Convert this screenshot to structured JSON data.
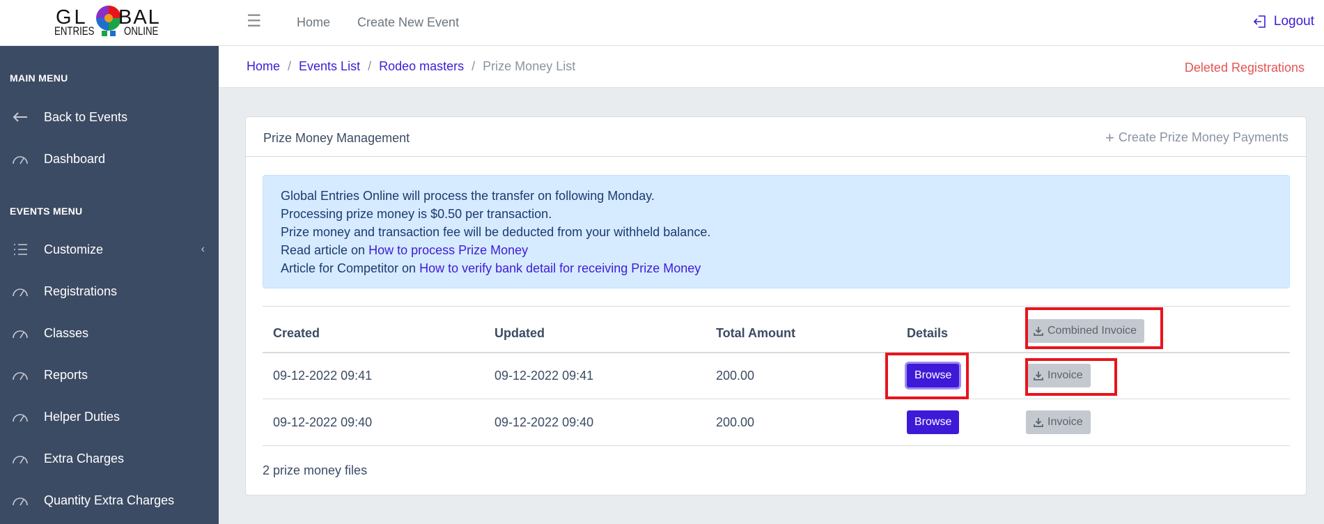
{
  "topbar": {
    "logo": {
      "line1_left": "GL",
      "line1_right": "BAL",
      "line2_left": "ENTRIES",
      "line2_right": "ONLINE"
    },
    "nav": [
      "Home",
      "Create New Event"
    ],
    "logout": "Logout"
  },
  "sidebar": {
    "main_heading": "MAIN MENU",
    "main_items": [
      {
        "label": "Back to Events",
        "icon": "arrow-left-icon"
      },
      {
        "label": "Dashboard",
        "icon": "speedometer-icon"
      }
    ],
    "events_heading": "EVENTS MENU",
    "events_items": [
      {
        "label": "Customize",
        "icon": "list-icon"
      },
      {
        "label": "Registrations",
        "icon": "speedometer-icon"
      },
      {
        "label": "Classes",
        "icon": "speedometer-icon"
      },
      {
        "label": "Reports",
        "icon": "speedometer-icon"
      },
      {
        "label": "Helper Duties",
        "icon": "speedometer-icon"
      },
      {
        "label": "Extra Charges",
        "icon": "speedometer-icon"
      },
      {
        "label": "Quantity Extra Charges",
        "icon": "speedometer-icon"
      }
    ]
  },
  "breadcrumb": {
    "items": [
      "Home",
      "Events List",
      "Rodeo masters"
    ],
    "current": "Prize Money List",
    "deleted_link": "Deleted Registrations"
  },
  "card": {
    "title": "Prize Money Management",
    "create_link": "Create Prize Money Payments",
    "alert": {
      "line1": "Global Entries Online will process the transfer on following Monday.",
      "line2": "Processing prize money is $0.50 per transaction.",
      "line3": "Prize money and transaction fee will be deducted from your withheld balance.",
      "line4_prefix": "Read article on ",
      "line4_link": "How to process Prize Money",
      "line5_prefix": "Article for Competitor on ",
      "line5_link": "How to verify bank detail for receiving Prize Money"
    },
    "table": {
      "headers": [
        "Created",
        "Updated",
        "Total Amount",
        "Details"
      ],
      "combined_invoice": "Combined Invoice",
      "rows": [
        {
          "created": "09-12-2022 09:41",
          "updated": "09-12-2022 09:41",
          "total": "200.00",
          "browse": "Browse",
          "invoice": "Invoice"
        },
        {
          "created": "09-12-2022 09:40",
          "updated": "09-12-2022 09:40",
          "total": "200.00",
          "browse": "Browse",
          "invoice": "Invoice"
        }
      ]
    },
    "footer": "2 prize money files"
  },
  "colors": {
    "primary": "#3e1ad8",
    "sidebar": "#3c4b64",
    "danger": "#e55353",
    "highlight": "#e8141c",
    "alert_bg": "#d6ebff"
  }
}
